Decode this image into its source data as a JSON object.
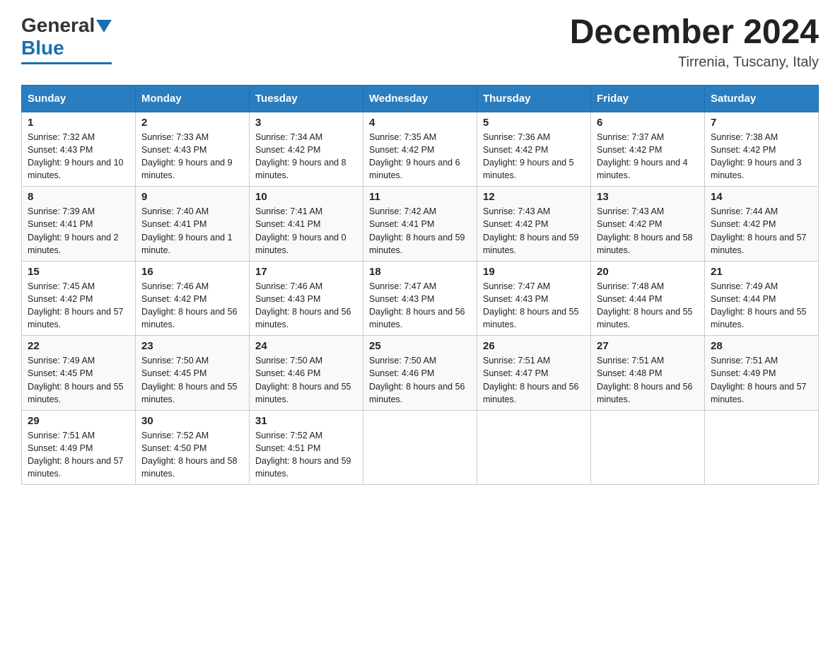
{
  "header": {
    "logo_general": "General",
    "logo_blue": "Blue",
    "month_title": "December 2024",
    "location": "Tirrenia, Tuscany, Italy"
  },
  "days_of_week": [
    "Sunday",
    "Monday",
    "Tuesday",
    "Wednesday",
    "Thursday",
    "Friday",
    "Saturday"
  ],
  "weeks": [
    [
      {
        "day": "1",
        "sunrise": "7:32 AM",
        "sunset": "4:43 PM",
        "daylight": "9 hours and 10 minutes."
      },
      {
        "day": "2",
        "sunrise": "7:33 AM",
        "sunset": "4:43 PM",
        "daylight": "9 hours and 9 minutes."
      },
      {
        "day": "3",
        "sunrise": "7:34 AM",
        "sunset": "4:42 PM",
        "daylight": "9 hours and 8 minutes."
      },
      {
        "day": "4",
        "sunrise": "7:35 AM",
        "sunset": "4:42 PM",
        "daylight": "9 hours and 6 minutes."
      },
      {
        "day": "5",
        "sunrise": "7:36 AM",
        "sunset": "4:42 PM",
        "daylight": "9 hours and 5 minutes."
      },
      {
        "day": "6",
        "sunrise": "7:37 AM",
        "sunset": "4:42 PM",
        "daylight": "9 hours and 4 minutes."
      },
      {
        "day": "7",
        "sunrise": "7:38 AM",
        "sunset": "4:42 PM",
        "daylight": "9 hours and 3 minutes."
      }
    ],
    [
      {
        "day": "8",
        "sunrise": "7:39 AM",
        "sunset": "4:41 PM",
        "daylight": "9 hours and 2 minutes."
      },
      {
        "day": "9",
        "sunrise": "7:40 AM",
        "sunset": "4:41 PM",
        "daylight": "9 hours and 1 minute."
      },
      {
        "day": "10",
        "sunrise": "7:41 AM",
        "sunset": "4:41 PM",
        "daylight": "9 hours and 0 minutes."
      },
      {
        "day": "11",
        "sunrise": "7:42 AM",
        "sunset": "4:41 PM",
        "daylight": "8 hours and 59 minutes."
      },
      {
        "day": "12",
        "sunrise": "7:43 AM",
        "sunset": "4:42 PM",
        "daylight": "8 hours and 59 minutes."
      },
      {
        "day": "13",
        "sunrise": "7:43 AM",
        "sunset": "4:42 PM",
        "daylight": "8 hours and 58 minutes."
      },
      {
        "day": "14",
        "sunrise": "7:44 AM",
        "sunset": "4:42 PM",
        "daylight": "8 hours and 57 minutes."
      }
    ],
    [
      {
        "day": "15",
        "sunrise": "7:45 AM",
        "sunset": "4:42 PM",
        "daylight": "8 hours and 57 minutes."
      },
      {
        "day": "16",
        "sunrise": "7:46 AM",
        "sunset": "4:42 PM",
        "daylight": "8 hours and 56 minutes."
      },
      {
        "day": "17",
        "sunrise": "7:46 AM",
        "sunset": "4:43 PM",
        "daylight": "8 hours and 56 minutes."
      },
      {
        "day": "18",
        "sunrise": "7:47 AM",
        "sunset": "4:43 PM",
        "daylight": "8 hours and 56 minutes."
      },
      {
        "day": "19",
        "sunrise": "7:47 AM",
        "sunset": "4:43 PM",
        "daylight": "8 hours and 55 minutes."
      },
      {
        "day": "20",
        "sunrise": "7:48 AM",
        "sunset": "4:44 PM",
        "daylight": "8 hours and 55 minutes."
      },
      {
        "day": "21",
        "sunrise": "7:49 AM",
        "sunset": "4:44 PM",
        "daylight": "8 hours and 55 minutes."
      }
    ],
    [
      {
        "day": "22",
        "sunrise": "7:49 AM",
        "sunset": "4:45 PM",
        "daylight": "8 hours and 55 minutes."
      },
      {
        "day": "23",
        "sunrise": "7:50 AM",
        "sunset": "4:45 PM",
        "daylight": "8 hours and 55 minutes."
      },
      {
        "day": "24",
        "sunrise": "7:50 AM",
        "sunset": "4:46 PM",
        "daylight": "8 hours and 55 minutes."
      },
      {
        "day": "25",
        "sunrise": "7:50 AM",
        "sunset": "4:46 PM",
        "daylight": "8 hours and 56 minutes."
      },
      {
        "day": "26",
        "sunrise": "7:51 AM",
        "sunset": "4:47 PM",
        "daylight": "8 hours and 56 minutes."
      },
      {
        "day": "27",
        "sunrise": "7:51 AM",
        "sunset": "4:48 PM",
        "daylight": "8 hours and 56 minutes."
      },
      {
        "day": "28",
        "sunrise": "7:51 AM",
        "sunset": "4:49 PM",
        "daylight": "8 hours and 57 minutes."
      }
    ],
    [
      {
        "day": "29",
        "sunrise": "7:51 AM",
        "sunset": "4:49 PM",
        "daylight": "8 hours and 57 minutes."
      },
      {
        "day": "30",
        "sunrise": "7:52 AM",
        "sunset": "4:50 PM",
        "daylight": "8 hours and 58 minutes."
      },
      {
        "day": "31",
        "sunrise": "7:52 AM",
        "sunset": "4:51 PM",
        "daylight": "8 hours and 59 minutes."
      },
      null,
      null,
      null,
      null
    ]
  ]
}
